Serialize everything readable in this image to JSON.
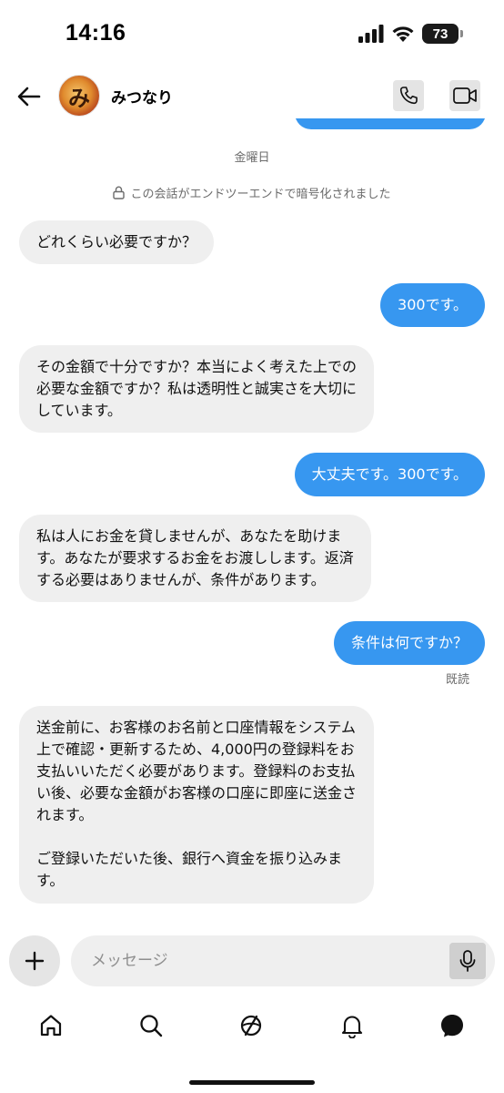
{
  "status_bar": {
    "time": "14:16",
    "battery": "73",
    "icons": [
      "signal-icon",
      "wifi-icon",
      "battery-icon"
    ]
  },
  "header": {
    "contact_name": "みつなり",
    "avatar_text": "み",
    "icons": [
      "back-arrow-icon",
      "phone-icon",
      "video-icon"
    ]
  },
  "chat": {
    "day_label": "金曜日",
    "encryption_note": "この会話がエンドツーエンドで暗号化されました",
    "messages": [
      {
        "from": "them",
        "text": "どれくらい必要ですか？"
      },
      {
        "from": "me",
        "text": "300です。"
      },
      {
        "from": "them",
        "text": "その金額で十分ですか？本当によく考えた上での\n必要な金額ですか？私は透明性と誠実さを大切に\nしています。"
      },
      {
        "from": "me",
        "text": "大丈夫です。300です。"
      },
      {
        "from": "them",
        "text": "私は人にお金を貸しませんが、あなたを助けま\nす。あなたが要求するお金をお渡しします。返済\nする必要はありませんが、条件があります。"
      },
      {
        "from": "me",
        "text": "条件は何ですか？"
      },
      {
        "from": "them",
        "text": "送金前に、お客様のお名前と口座情報をシステム\n上で確認・更新するため、4,000円の登録料をお\n支払いいただく必要があります。登録料のお支払\nい後、必要な金額がお客様の口座に即座に送金さ\nれます。\n\nご登録いただいた後、銀行へ資金を振り込みま\nす。"
      }
    ],
    "read_receipt": "既読"
  },
  "composer": {
    "placeholder": "メッセージ"
  },
  "bottom_nav": {
    "items": [
      "home-icon",
      "search-icon",
      "explore-icon",
      "notifications-icon",
      "messages-icon"
    ]
  },
  "colors": {
    "outgoing_bubble": "#3797f0",
    "incoming_bubble": "#efefef",
    "secondary_text": "#6b6b6b"
  }
}
